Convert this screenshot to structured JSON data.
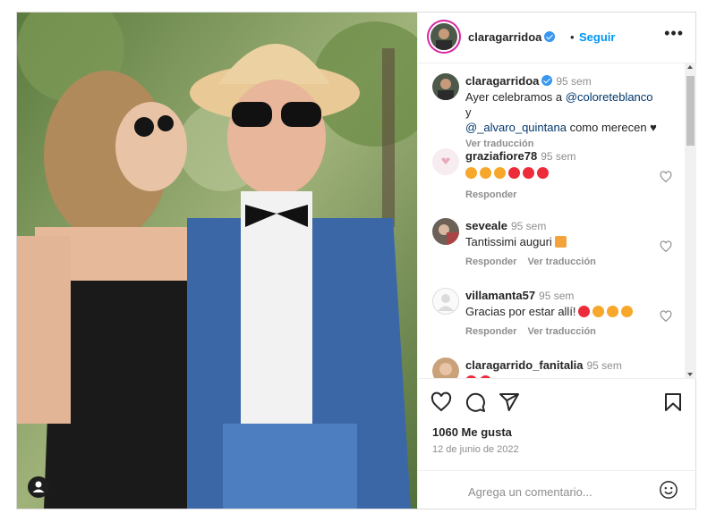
{
  "post": {
    "author": "claragarridoa",
    "follow_label": "Seguir",
    "dot": "•",
    "more_label": "•••",
    "caption": {
      "username": "claragarridoa",
      "time": "95 sem",
      "text_before": "Ayer celebramos a ",
      "mention1": "@coloreteblanco",
      "text_mid": " y ",
      "mention2": "@_alvaro_quintana",
      "text_after": " como merecen ♥",
      "translate": "Ver traducción"
    },
    "comments": [
      {
        "username": "graziafiore78",
        "time": "95 sem",
        "reply": "Responder",
        "translate": ""
      },
      {
        "username": "seveale",
        "time": "95 sem",
        "text": "Tantissimi auguri",
        "reply": "Responder",
        "translate": "Ver traducción"
      },
      {
        "username": "villamanta57",
        "time": "95 sem",
        "text": "Gracias por estar allí!",
        "reply": "Responder",
        "translate": "Ver traducción"
      },
      {
        "username": "claragarrido_fanitalia",
        "time": "95 sem"
      }
    ],
    "likes": "1060 Me gusta",
    "date": "12 de junio de 2022",
    "comment_placeholder": "Agrega un comentario..."
  },
  "colors": {
    "link": "#0095f6",
    "verified": "#3897f0",
    "like_heart_emoji": "#ed2b3a",
    "star_eyes_emoji": "#f7a72a"
  },
  "icons": [
    "verified-badge-icon",
    "more-options-icon",
    "heart-icon",
    "comment-icon",
    "share-icon",
    "bookmark-icon",
    "emoji-icon",
    "tag-person-icon"
  ]
}
